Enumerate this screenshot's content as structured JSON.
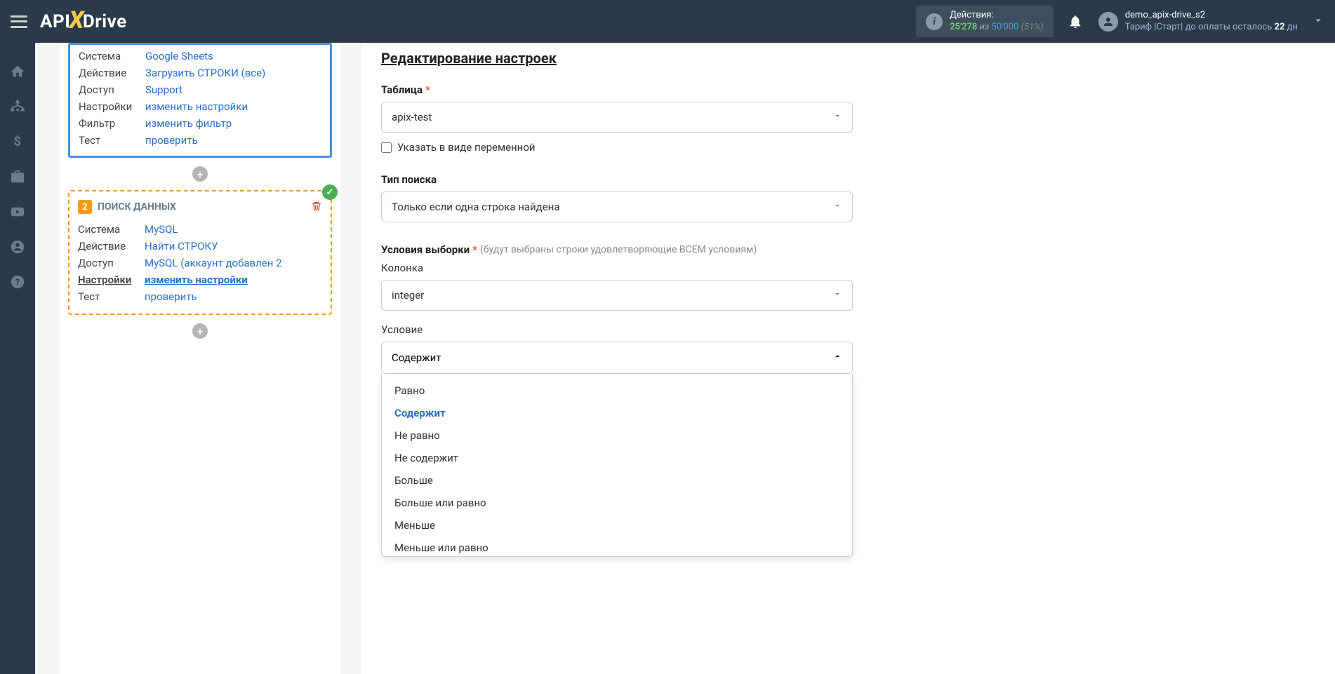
{
  "header": {
    "actions_label": "Действия:",
    "actions_used": "25'278",
    "actions_iz": "из",
    "actions_total": "50'000",
    "actions_pct": "(51%)",
    "user_name": "demo_apix-drive_s2",
    "tariff_prefix": "Тариф |Старт| до оплаты осталось ",
    "tariff_days": "22",
    "tariff_suffix": " дн"
  },
  "card1": {
    "rows": [
      {
        "label": "Система",
        "value": "Google Sheets"
      },
      {
        "label": "Действие",
        "value": "Загрузить СТРОКИ (все)"
      },
      {
        "label": "Доступ",
        "value": "Support"
      },
      {
        "label": "Настройки",
        "value": "изменить настройки"
      },
      {
        "label": "Фильтр",
        "value": "изменить фильтр"
      },
      {
        "label": "Тест",
        "value": "проверить"
      }
    ]
  },
  "card2": {
    "num": "2",
    "title": "ПОИСК ДАННЫХ",
    "rows": [
      {
        "label": "Система",
        "value": "MySQL"
      },
      {
        "label": "Действие",
        "value": "Найти СТРОКУ"
      },
      {
        "label": "Доступ",
        "value": "MySQL (аккаунт добавлен 2"
      },
      {
        "label": "Настройки",
        "value": "изменить настройки",
        "u": true
      },
      {
        "label": "Тест",
        "value": "проверить"
      }
    ]
  },
  "form": {
    "title": "Редактирование настроек",
    "table_label": "Таблица",
    "table_value": "apix-test",
    "var_checkbox": "Указать в виде переменной",
    "search_type_label": "Тип поиска",
    "search_type_value": "Только если одна строка найдена",
    "conditions_label": "Условия выборки",
    "conditions_hint": "(будут выбраны строки удовлетворяющие ВСЕМ условиям)",
    "column_label": "Колонка",
    "column_value": "integer",
    "condition_label": "Условие",
    "condition_value": "Содержит",
    "options": [
      "Равно",
      "Содержит",
      "Не равно",
      "Не содержит",
      "Больше",
      "Больше или равно",
      "Меньше",
      "Меньше или равно"
    ]
  }
}
